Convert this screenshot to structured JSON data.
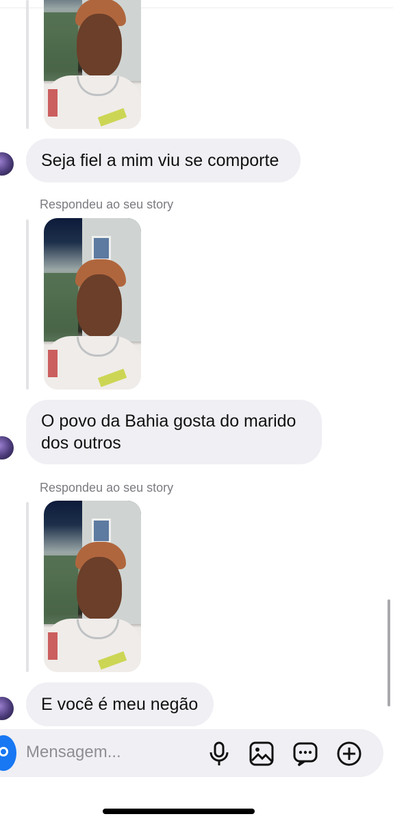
{
  "messages": [
    {
      "type": "story",
      "text": "Seja fiel a mim viu se comporte"
    },
    {
      "type": "story",
      "meta": "Respondeu ao seu story",
      "text": "O povo da Bahia gosta do marido dos outros"
    },
    {
      "type": "story",
      "meta": "Respondeu ao seu story",
      "text": "E você é meu negão"
    }
  ],
  "composer": {
    "placeholder": "Mensagem...",
    "icons": [
      "camera-icon",
      "microphone-icon",
      "image-icon",
      "sticker-chat-icon",
      "plus-icon"
    ]
  },
  "colors": {
    "bubble": "#efeff4",
    "accent": "#1877f2",
    "meta_text": "#7a7a80"
  }
}
